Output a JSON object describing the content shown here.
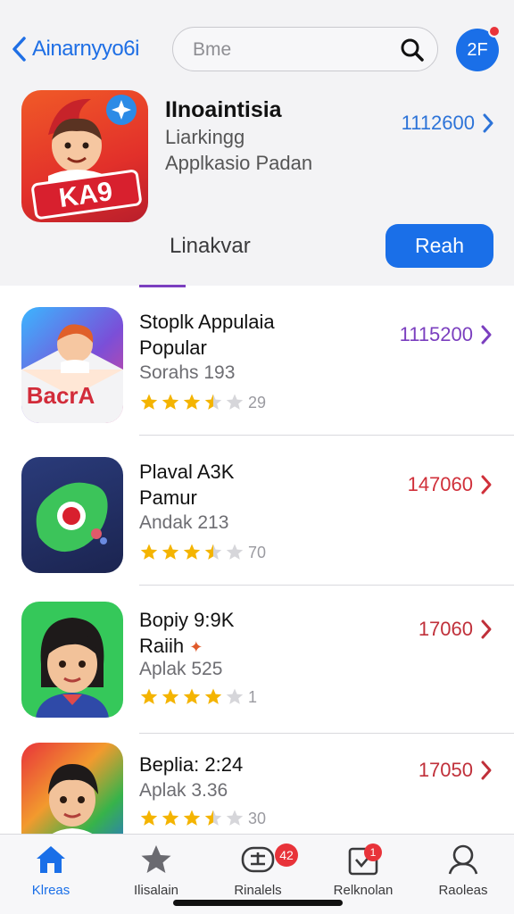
{
  "nav": {
    "back_label": "Ainarnyyo6i",
    "search_placeholder": "Bme",
    "avatar_text": "2F"
  },
  "featured": {
    "title": "IInoaintisia",
    "subtitle1": "Liarkingg",
    "subtitle2": "Applkasio Padan",
    "price": "1112600",
    "icon_text": "KA9",
    "tab_label": "Linakvar",
    "button_label": "Reah"
  },
  "apps": [
    {
      "name_line1": "Stoplk Appulaia",
      "name_line2": "Popular",
      "meta": "Sorahs 193",
      "rating": 3.5,
      "rating_count": "29",
      "price": "1115200",
      "price_color": "#7b3fbf",
      "icon_text": "BacrA"
    },
    {
      "name_line1": "Plaval A3K",
      "name_line2": "Pamur",
      "meta": "Andak 213",
      "rating": 3.5,
      "rating_count": "70",
      "price": "147060",
      "price_color": "#d0303a",
      "icon_text": ""
    },
    {
      "name_line1": "Bopiy 9:9K",
      "name_line2": "Raiih",
      "meta": "Aplak 525",
      "rating": 4,
      "rating_count": "1",
      "price": "17060",
      "price_color": "#c0303a",
      "icon_text": ""
    },
    {
      "name_line1": "Beplia: 2:24",
      "name_line2": "",
      "meta": "Aplak 3.36",
      "rating": 3.5,
      "rating_count": "30",
      "price": "17050",
      "price_color": "#c0303a",
      "icon_text": ""
    }
  ],
  "tabbar": {
    "tabs": [
      {
        "label": "Klreas",
        "icon": "home-icon"
      },
      {
        "label": "Ilisalain",
        "icon": "star-icon"
      },
      {
        "label": "Rinalels",
        "icon": "updates-icon",
        "badge": "42"
      },
      {
        "label": "Relknolan",
        "icon": "download-icon",
        "badge": "1"
      },
      {
        "label": "Raoleas",
        "icon": "profile-icon"
      }
    ]
  },
  "colors": {
    "accent": "#1a6fe8",
    "star": "#f4b400",
    "badge": "#e8333a"
  }
}
